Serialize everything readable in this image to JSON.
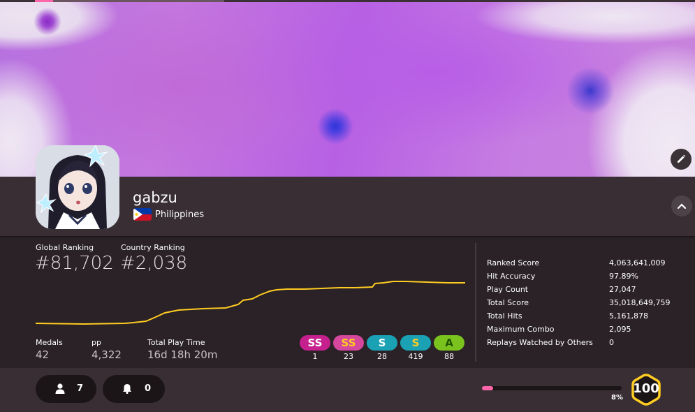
{
  "profile": {
    "username": "gabzu",
    "country": "Philippines",
    "country_flag": "flag-philippines"
  },
  "rankings": {
    "global_label": "Global Ranking",
    "global_value": "#81,702",
    "country_label": "Country Ranking",
    "country_value": "#2,038"
  },
  "rank_history": {
    "line_color": "#ffcc22",
    "trend": "rank improving over time"
  },
  "summary": {
    "medals_label": "Medals",
    "medals_value": "42",
    "pp_label": "pp",
    "pp_value": "4,322",
    "playtime_label": "Total Play Time",
    "playtime_value": "16d 18h 20m"
  },
  "grades": [
    {
      "label": "SS",
      "count": "1",
      "bg": "#c61f8e",
      "fg": "#ffffff"
    },
    {
      "label": "SS",
      "count": "23",
      "bg": "#d4479c",
      "fg": "#ffcc22"
    },
    {
      "label": "S",
      "count": "28",
      "bg": "#1aa1b3",
      "fg": "#ffffff"
    },
    {
      "label": "S",
      "count": "419",
      "bg": "#1aa1b3",
      "fg": "#ffcc22"
    },
    {
      "label": "A",
      "count": "88",
      "bg": "#7ac31f",
      "fg": "#225500"
    }
  ],
  "detail_stats": [
    {
      "label": "Ranked Score",
      "value": "4,063,641,009"
    },
    {
      "label": "Hit Accuracy",
      "value": "97.89%"
    },
    {
      "label": "Play Count",
      "value": "27,047"
    },
    {
      "label": "Total Score",
      "value": "35,018,649,759"
    },
    {
      "label": "Total Hits",
      "value": "5,161,878"
    },
    {
      "label": "Maximum Combo",
      "value": "2,095"
    },
    {
      "label": "Replays Watched by Others",
      "value": "0"
    }
  ],
  "footer": {
    "followers": "7",
    "subscribers": "0",
    "level": "100",
    "level_progress_label": "8%",
    "level_progress": 0.08,
    "accent_color": "#ff66aa",
    "level_color": "#ffcc22"
  },
  "icons": {
    "edit": "pencil-icon",
    "collapse": "chevron-up-icon",
    "followers": "user-icon",
    "subscribers": "bell-icon"
  }
}
